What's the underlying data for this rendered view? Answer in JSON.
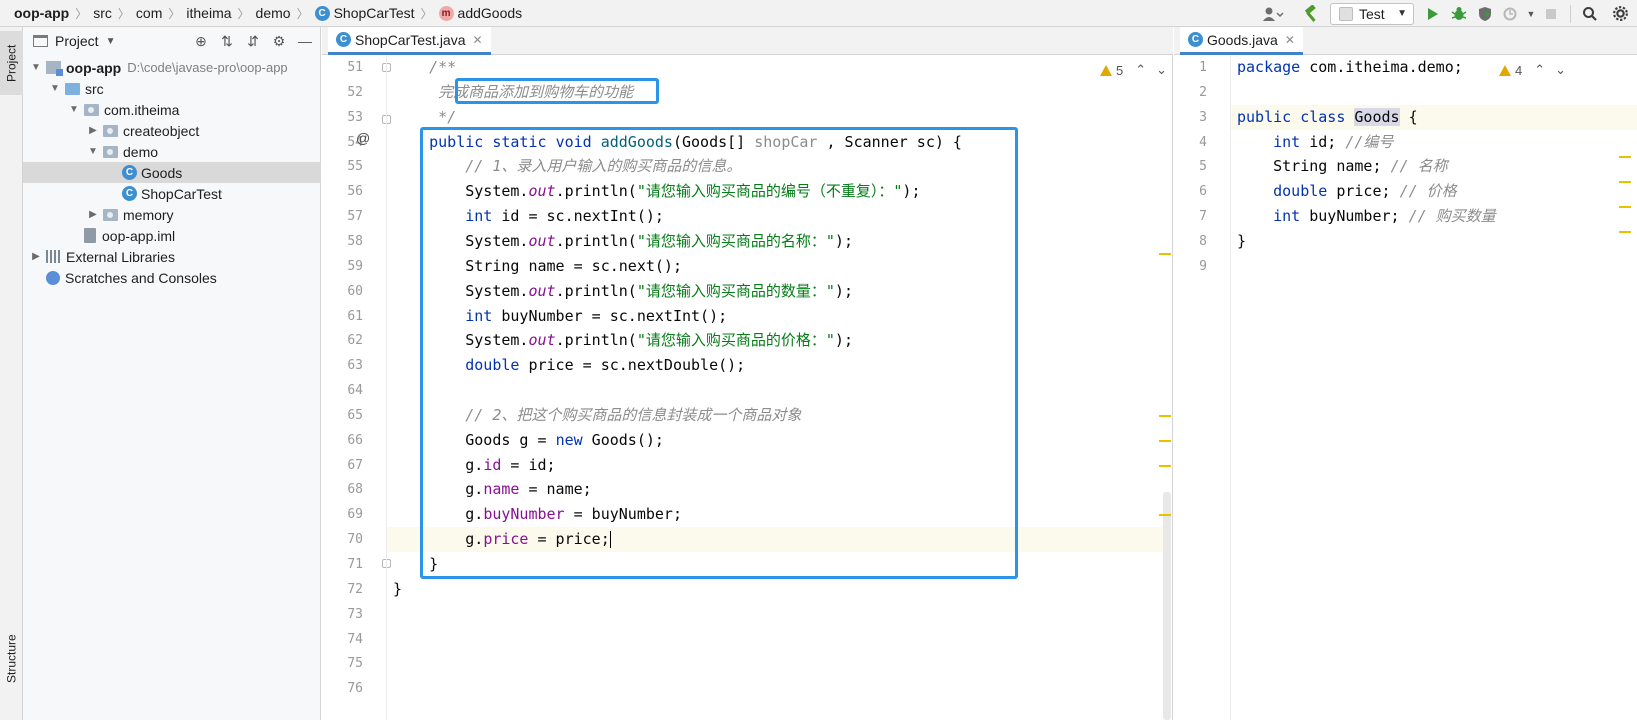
{
  "breadcrumb": {
    "items": [
      {
        "label": "oop-app",
        "bold": true
      },
      {
        "label": "src"
      },
      {
        "label": "com"
      },
      {
        "label": "itheima"
      },
      {
        "label": "demo"
      },
      {
        "label": "ShopCarTest",
        "icon": "class-icon"
      },
      {
        "label": "addGoods",
        "icon": "method-icon"
      }
    ]
  },
  "toolbar": {
    "run_config": "Test",
    "icons": [
      "user-icon",
      "hammer-icon",
      "run-icon",
      "debug-icon",
      "coverage-icon",
      "profile-icon",
      "stop-icon",
      "search-icon"
    ]
  },
  "side_tabs": {
    "project": "Project",
    "structure": "Structure"
  },
  "project_panel": {
    "title": "Project",
    "tree": [
      {
        "label": "oop-app",
        "path": "D:\\code\\javase-pro\\oop-app",
        "depth": 0,
        "expanded": true,
        "kind": "module"
      },
      {
        "label": "src",
        "depth": 1,
        "expanded": true,
        "kind": "folder-blue"
      },
      {
        "label": "com.itheima",
        "depth": 2,
        "expanded": true,
        "kind": "package"
      },
      {
        "label": "createobject",
        "depth": 3,
        "expanded": false,
        "kind": "package"
      },
      {
        "label": "demo",
        "depth": 3,
        "expanded": true,
        "kind": "package"
      },
      {
        "label": "Goods",
        "depth": 4,
        "kind": "class",
        "selected": true
      },
      {
        "label": "ShopCarTest",
        "depth": 4,
        "kind": "class-run"
      },
      {
        "label": "memory",
        "depth": 3,
        "expanded": false,
        "kind": "package"
      },
      {
        "label": "oop-app.iml",
        "depth": 2,
        "kind": "file"
      },
      {
        "label": "External Libraries",
        "depth": 0,
        "expanded": false,
        "kind": "library"
      },
      {
        "label": "Scratches and Consoles",
        "depth": 0,
        "kind": "scratch"
      }
    ]
  },
  "left_editor": {
    "tab": "ShopCarTest.java",
    "warnings": "5",
    "line_numbers": [
      "51",
      "52",
      "53",
      "54",
      "55",
      "56",
      "57",
      "58",
      "59",
      "60",
      "61",
      "62",
      "63",
      "64",
      "65",
      "66",
      "67",
      "68",
      "69",
      "70",
      "71",
      "72",
      "73",
      "74",
      "75",
      "76"
    ],
    "lines": [
      "    /**",
      "     完成商品添加到购物车的功能",
      "     */",
      "    public static void addGoods(Goods[] shopCar , Scanner sc) {",
      "        // 1、录入用户输入的购买商品的信息。",
      "        System.out.println(\"请您输入购买商品的编号（不重复）：\");",
      "        int id = sc.nextInt();",
      "        System.out.println(\"请您输入购买商品的名称：\");",
      "        String name = sc.next();",
      "        System.out.println(\"请您输入购买商品的数量：\");",
      "        int buyNumber = sc.nextInt();",
      "        System.out.println(\"请您输入购买商品的价格：\");",
      "        double price = sc.nextDouble();",
      "",
      "        // 2、把这个购买商品的信息封装成一个商品对象",
      "        Goods g = new Goods();",
      "        g.id = id;",
      "        g.name = name;",
      "        g.buyNumber = buyNumber;",
      "        g.price = price;",
      "    }",
      "}",
      "",
      "",
      "",
      ""
    ]
  },
  "right_editor": {
    "tab": "Goods.java",
    "warnings": "4",
    "line_numbers": [
      "1",
      "2",
      "3",
      "4",
      "5",
      "6",
      "7",
      "8",
      "9"
    ],
    "lines": [
      "package com.itheima.demo;",
      "",
      "public class Goods {",
      "    int id; //编号",
      "    String name; // 名称",
      "    double price; // 价格",
      "    int buyNumber; // 购买数量",
      "}",
      ""
    ]
  },
  "colors": {
    "keyword": "#0033b3",
    "string": "#067d17",
    "comment": "#8c8c8c",
    "field": "#871094",
    "highlight_box": "#2b94e8",
    "warning": "#e0a800"
  }
}
